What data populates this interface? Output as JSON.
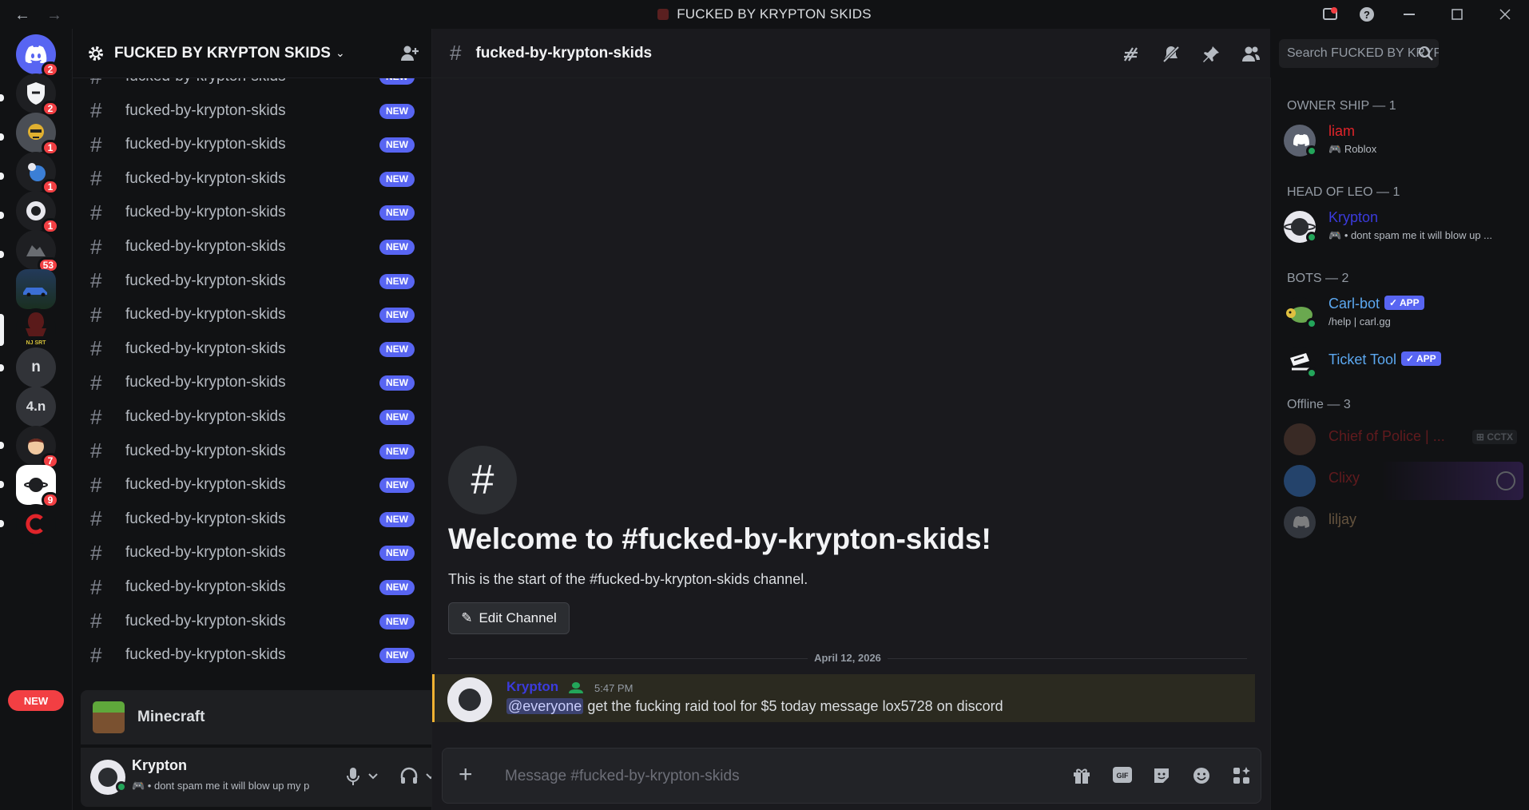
{
  "window": {
    "title": "FUCKED BY KRYPTON SKIDS",
    "nav_back": "←",
    "nav_forward": "→"
  },
  "rail": {
    "badges": [
      "2",
      "2",
      "1",
      "1",
      "1",
      "53",
      "7",
      "9"
    ],
    "text_guilds": [
      "n",
      "4.n"
    ],
    "new_label": "NEW"
  },
  "server": {
    "name": "FUCKED BY KRYPTON SKIDS"
  },
  "channels": {
    "items": [
      {
        "name": "fucked-by-krypton-skids",
        "badge": "NEW"
      },
      {
        "name": "fucked-by-krypton-skids",
        "badge": "NEW"
      },
      {
        "name": "fucked-by-krypton-skids",
        "badge": "NEW"
      },
      {
        "name": "fucked-by-krypton-skids",
        "badge": "NEW"
      },
      {
        "name": "fucked-by-krypton-skids",
        "badge": "NEW"
      },
      {
        "name": "fucked-by-krypton-skids",
        "badge": "NEW"
      },
      {
        "name": "fucked-by-krypton-skids",
        "badge": "NEW"
      },
      {
        "name": "fucked-by-krypton-skids",
        "badge": "NEW"
      },
      {
        "name": "fucked-by-krypton-skids",
        "badge": "NEW"
      },
      {
        "name": "fucked-by-krypton-skids",
        "badge": "NEW"
      },
      {
        "name": "fucked-by-krypton-skids",
        "badge": "NEW"
      },
      {
        "name": "fucked-by-krypton-skids",
        "badge": "NEW"
      },
      {
        "name": "fucked-by-krypton-skids",
        "badge": "NEW"
      },
      {
        "name": "fucked-by-krypton-skids",
        "badge": "NEW"
      },
      {
        "name": "fucked-by-krypton-skids",
        "badge": "NEW"
      },
      {
        "name": "fucked-by-krypton-skids",
        "badge": "NEW"
      },
      {
        "name": "fucked-by-krypton-skids",
        "badge": "NEW"
      },
      {
        "name": "fucked-by-krypton-skids",
        "badge": "NEW"
      }
    ]
  },
  "activity": {
    "game": "Minecraft"
  },
  "user": {
    "name": "Krypton",
    "status": "dont spam me it will blow up my p"
  },
  "channel_header": {
    "hash": "#",
    "name": "fucked-by-krypton-skids",
    "search_placeholder": "Search FUCKED BY KRYPTON S..."
  },
  "welcome": {
    "hash": "#",
    "title": "Welcome to #fucked-by-krypton-skids!",
    "subtitle": "This is the start of the #fucked-by-krypton-skids channel.",
    "edit_button": "Edit Channel"
  },
  "messages": {
    "date_divider": "April 12, 2026",
    "items": [
      {
        "author": "Krypton",
        "time": "5:47 PM",
        "mention": "@everyone",
        "text": "get the fucking raid tool for $5 today message lox5728 on discord"
      }
    ]
  },
  "composer": {
    "placeholder": "Message #fucked-by-krypton-skids"
  },
  "members": {
    "groups": [
      {
        "title": "OWNER SHIP — 1"
      },
      {
        "title": "HEAD OF LEO — 1"
      },
      {
        "title": "BOTS — 2"
      },
      {
        "title": "Offline — 3"
      }
    ],
    "online": [
      {
        "name": "liam",
        "sub": "Roblox",
        "color": "#e0242a"
      },
      {
        "name": "Krypton",
        "sub": "• dont spam me it will blow up ...",
        "color": "#3b3bdc"
      },
      {
        "name": "Carl-bot",
        "tag": "APP",
        "sub": "/help | carl.gg",
        "color": "#5ca8f0"
      },
      {
        "name": "Ticket Tool",
        "tag": "APP",
        "sub": "",
        "color": "#5ca8f0"
      }
    ],
    "offline": [
      {
        "name": "Chief of Police | ...",
        "tag": "CCTX",
        "color": "#c0242a"
      },
      {
        "name": "Clixy",
        "color": "#c0242a"
      },
      {
        "name": "liljay",
        "color": "#c8a070"
      }
    ]
  },
  "colors": {
    "blurple": "#5865f2",
    "danger": "#f23f43",
    "online": "#23a55a",
    "mention_highlight": "#f0b232"
  }
}
